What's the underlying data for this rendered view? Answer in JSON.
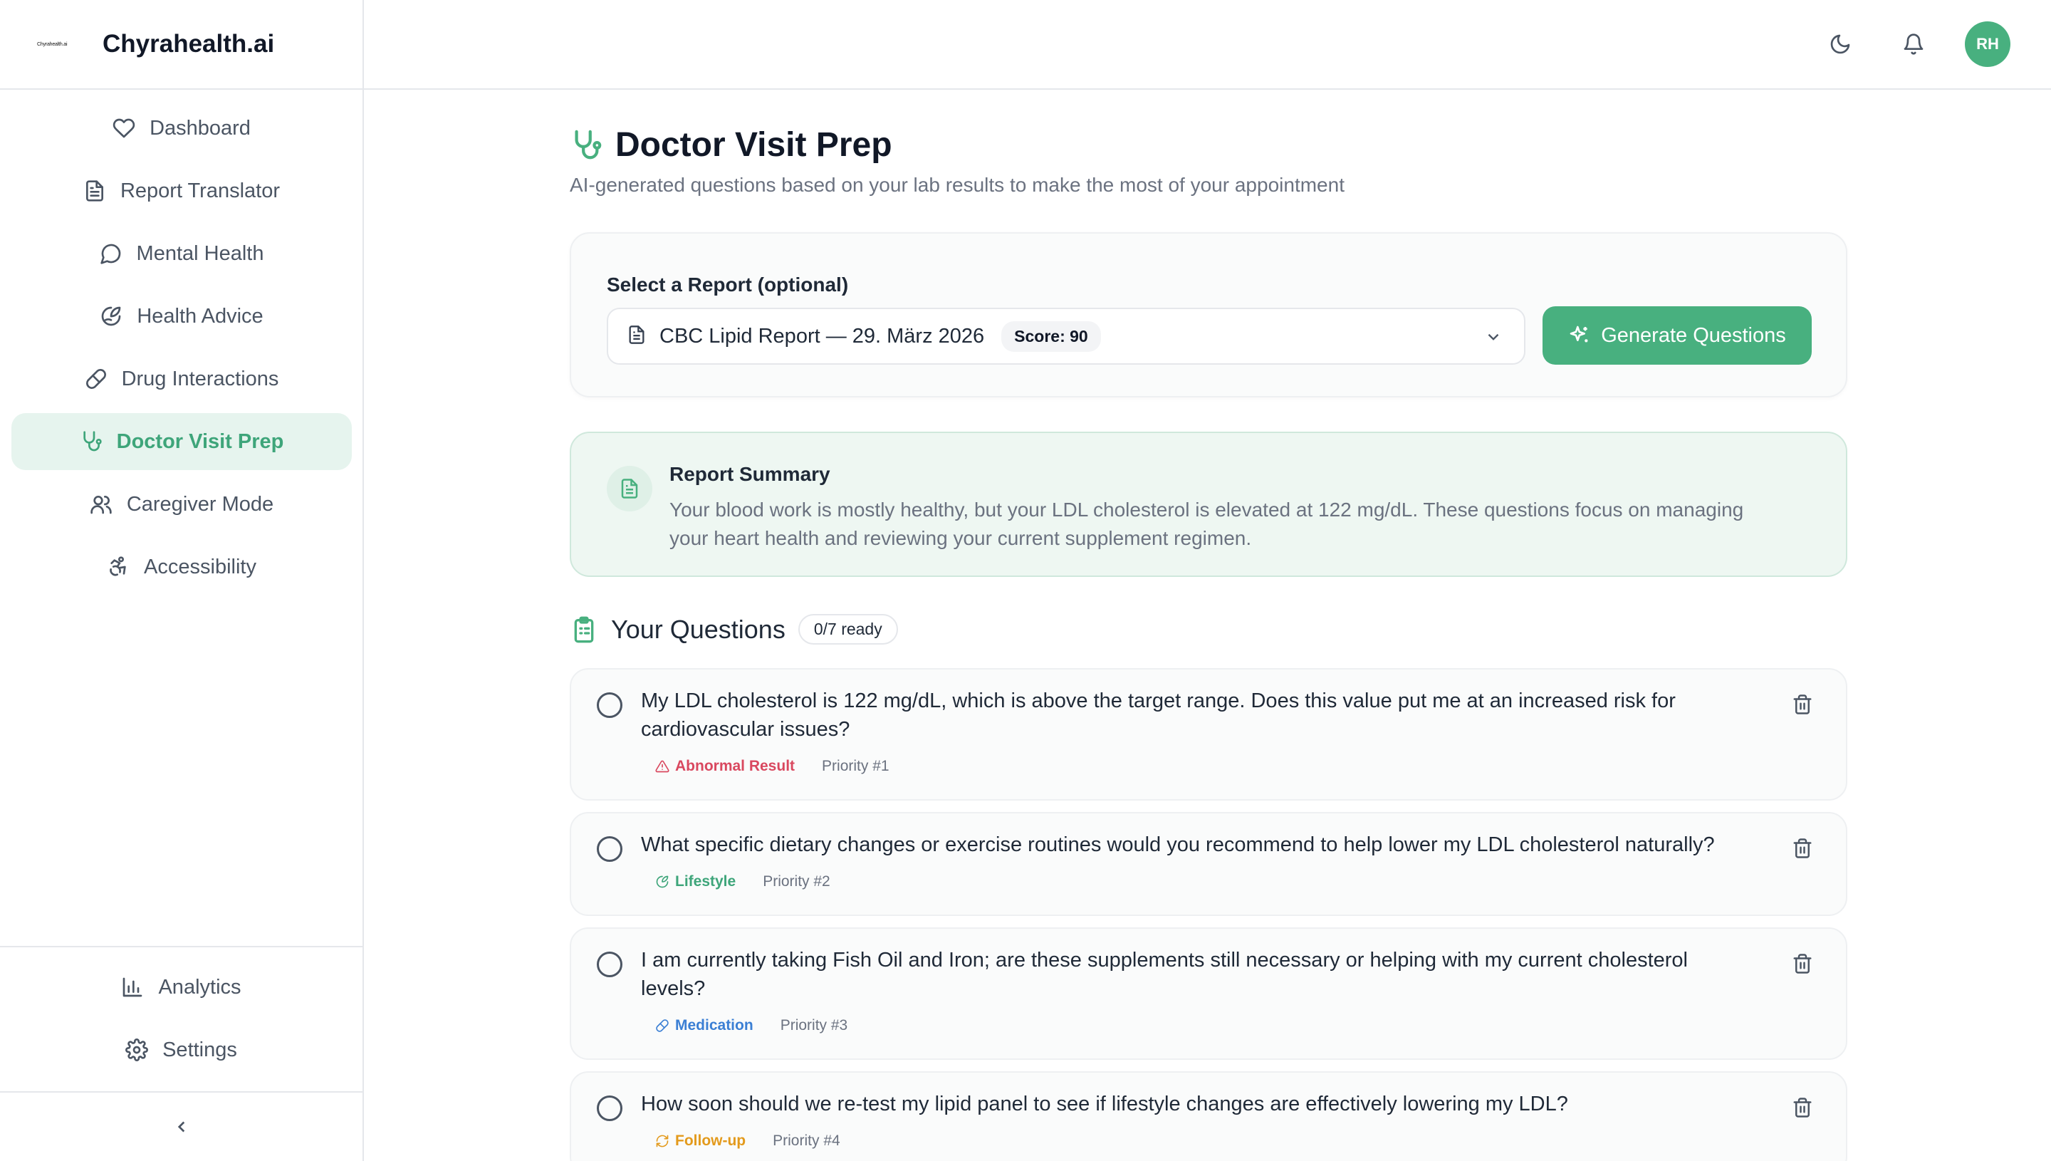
{
  "brand": {
    "logo_text": "Chyrahealth.ai",
    "name": "Chyrahealth.ai"
  },
  "sidebar": {
    "items": [
      {
        "label": "Dashboard",
        "icon": "heart-icon"
      },
      {
        "label": "Report Translator",
        "icon": "document-icon"
      },
      {
        "label": "Mental Health",
        "icon": "chat-icon"
      },
      {
        "label": "Health Advice",
        "icon": "leaf-icon"
      },
      {
        "label": "Drug Interactions",
        "icon": "pill-icon"
      },
      {
        "label": "Doctor Visit Prep",
        "icon": "stethoscope-icon",
        "active": true
      },
      {
        "label": "Caregiver Mode",
        "icon": "users-icon"
      },
      {
        "label": "Accessibility",
        "icon": "accessibility-icon"
      }
    ],
    "bottom_items": [
      {
        "label": "Analytics",
        "icon": "bar-chart-icon"
      },
      {
        "label": "Settings",
        "icon": "gear-icon"
      }
    ]
  },
  "topbar": {
    "avatar_initials": "RH"
  },
  "page": {
    "title": "Doctor Visit Prep",
    "subtitle": "AI-generated questions based on your lab results to make the most of your appointment"
  },
  "report_select": {
    "label": "Select a Report (optional)",
    "selected": "CBC Lipid Report — 29. März 2026",
    "score": "Score: 90",
    "generate_label": "Generate Questions"
  },
  "summary": {
    "title": "Report Summary",
    "text": "Your blood work is mostly healthy, but your LDL cholesterol is elevated at 122 mg/dL. These questions focus on managing your heart health and reviewing your current supplement regimen."
  },
  "questions": {
    "title": "Your Questions",
    "ready": "0/7 ready",
    "items": [
      {
        "text": "My LDL cholesterol is 122 mg/dL, which is above the target range. Does this value put me at an increased risk for cardiovascular issues?",
        "tag": "Abnormal Result",
        "tag_color": "#d9485f",
        "priority": "Priority #1"
      },
      {
        "text": "What specific dietary changes or exercise routines would you recommend to help lower my LDL cholesterol naturally?",
        "tag": "Lifestyle",
        "tag_color": "#3ea57a",
        "priority": "Priority #2"
      },
      {
        "text": "I am currently taking Fish Oil and Iron; are these supplements still necessary or helping with my current cholesterol levels?",
        "tag": "Medication",
        "tag_color": "#3b7fd4",
        "priority": "Priority #3"
      },
      {
        "text": "How soon should we re-test my lipid panel to see if lifestyle changes are effectively lowering my LDL?",
        "tag": "Follow-up",
        "tag_color": "#e39a1c",
        "priority": "Priority #4"
      }
    ]
  },
  "colors": {
    "accent": "#48b07f",
    "accent_bg": "#e6f4ee"
  }
}
